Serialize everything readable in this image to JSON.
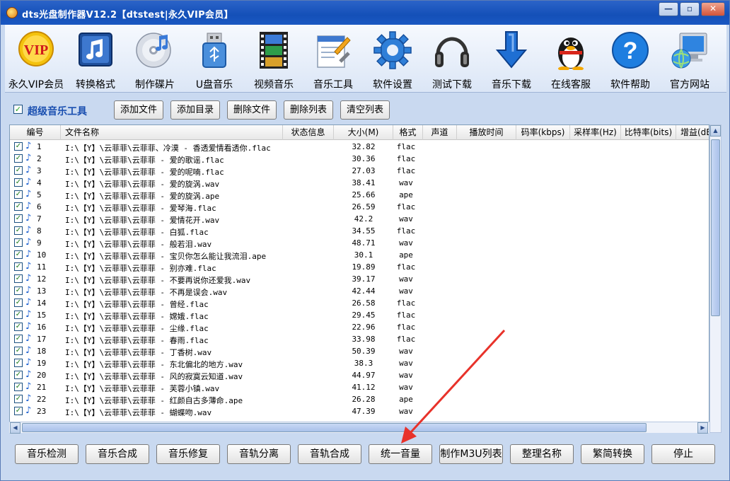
{
  "window": {
    "title": "dts光盘制作器V12.2【dtstest|永久VIP会员】",
    "controls": {
      "minimize": "—",
      "restore": "▫",
      "close": "✕"
    }
  },
  "toolbar": {
    "items": [
      {
        "label": "永久VIP会员",
        "icon": "vip-badge-icon"
      },
      {
        "label": "转换格式",
        "icon": "music-note-icon"
      },
      {
        "label": "制作碟片",
        "icon": "disc-icon"
      },
      {
        "label": "U盘音乐",
        "icon": "usb-drive-icon"
      },
      {
        "label": "视频音乐",
        "icon": "film-strip-icon"
      },
      {
        "label": "音乐工具",
        "icon": "tools-document-icon"
      },
      {
        "label": "软件设置",
        "icon": "gear-icon"
      },
      {
        "label": "测试下载",
        "icon": "headphones-icon"
      },
      {
        "label": "音乐下载",
        "icon": "download-arrow-icon"
      },
      {
        "label": "在线客服",
        "icon": "penguin-icon"
      },
      {
        "label": "软件帮助",
        "icon": "question-icon"
      },
      {
        "label": "官方网站",
        "icon": "computer-globe-icon"
      }
    ]
  },
  "panel": {
    "title": "超级音乐工具",
    "buttons": [
      "添加文件",
      "添加目录",
      "删除文件",
      "删除列表",
      "清空列表"
    ]
  },
  "list": {
    "columns": [
      "编号",
      "文件名称",
      "状态信息",
      "大小(M)",
      "格式",
      "声道",
      "播放时间",
      "码率(kbps)",
      "采样率(Hz)",
      "比特率(bits)",
      "增益(dB"
    ],
    "rows": [
      {
        "num": "1",
        "name": "I:\\【Y】\\云菲菲\\云菲菲、冷漠 - 香透爱情看透你.flac",
        "size": "32.82",
        "fmt": "flac"
      },
      {
        "num": "2",
        "name": "I:\\【Y】\\云菲菲\\云菲菲 - 爱的歌谣.flac",
        "size": "30.36",
        "fmt": "flac"
      },
      {
        "num": "3",
        "name": "I:\\【Y】\\云菲菲\\云菲菲 - 爱的呢喃.flac",
        "size": "27.03",
        "fmt": "flac"
      },
      {
        "num": "4",
        "name": "I:\\【Y】\\云菲菲\\云菲菲 - 爱的旋涡.wav",
        "size": "38.41",
        "fmt": "wav"
      },
      {
        "num": "5",
        "name": "I:\\【Y】\\云菲菲\\云菲菲 - 爱的旋涡.ape",
        "size": "25.66",
        "fmt": "ape"
      },
      {
        "num": "6",
        "name": "I:\\【Y】\\云菲菲\\云菲菲 - 爱琴海.flac",
        "size": "26.59",
        "fmt": "flac"
      },
      {
        "num": "7",
        "name": "I:\\【Y】\\云菲菲\\云菲菲 - 爱情花开.wav",
        "size": "42.2",
        "fmt": "wav"
      },
      {
        "num": "8",
        "name": "I:\\【Y】\\云菲菲\\云菲菲 - 白狐.flac",
        "size": "34.55",
        "fmt": "flac"
      },
      {
        "num": "9",
        "name": "I:\\【Y】\\云菲菲\\云菲菲 - 般若泪.wav",
        "size": "48.71",
        "fmt": "wav"
      },
      {
        "num": "10",
        "name": "I:\\【Y】\\云菲菲\\云菲菲 - 宝贝你怎么能让我流泪.ape",
        "size": "30.1",
        "fmt": "ape"
      },
      {
        "num": "11",
        "name": "I:\\【Y】\\云菲菲\\云菲菲 - 别亦难.flac",
        "size": "19.89",
        "fmt": "flac"
      },
      {
        "num": "12",
        "name": "I:\\【Y】\\云菲菲\\云菲菲 - 不要再说你还爱我.wav",
        "size": "39.17",
        "fmt": "wav"
      },
      {
        "num": "13",
        "name": "I:\\【Y】\\云菲菲\\云菲菲 - 不再是误会.wav",
        "size": "42.44",
        "fmt": "wav"
      },
      {
        "num": "14",
        "name": "I:\\【Y】\\云菲菲\\云菲菲 - 曾经.flac",
        "size": "26.58",
        "fmt": "flac"
      },
      {
        "num": "15",
        "name": "I:\\【Y】\\云菲菲\\云菲菲 - 嫦娥.flac",
        "size": "29.45",
        "fmt": "flac"
      },
      {
        "num": "16",
        "name": "I:\\【Y】\\云菲菲\\云菲菲 - 尘缘.flac",
        "size": "22.96",
        "fmt": "flac"
      },
      {
        "num": "17",
        "name": "I:\\【Y】\\云菲菲\\云菲菲 - 春雨.flac",
        "size": "33.98",
        "fmt": "flac"
      },
      {
        "num": "18",
        "name": "I:\\【Y】\\云菲菲\\云菲菲 - 丁香树.wav",
        "size": "50.39",
        "fmt": "wav"
      },
      {
        "num": "19",
        "name": "I:\\【Y】\\云菲菲\\云菲菲 - 东北偏北的地方.wav",
        "size": "38.3",
        "fmt": "wav"
      },
      {
        "num": "20",
        "name": "I:\\【Y】\\云菲菲\\云菲菲 - 风的寂寞云知道.wav",
        "size": "44.97",
        "fmt": "wav"
      },
      {
        "num": "21",
        "name": "I:\\【Y】\\云菲菲\\云菲菲 - 芙蓉小镇.wav",
        "size": "41.12",
        "fmt": "wav"
      },
      {
        "num": "22",
        "name": "I:\\【Y】\\云菲菲\\云菲菲 - 红颜自古多薄命.ape",
        "size": "26.28",
        "fmt": "ape"
      },
      {
        "num": "23",
        "name": "I:\\【Y】\\云菲菲\\云菲菲 - 蝴蝶吻.wav",
        "size": "47.39",
        "fmt": "wav"
      }
    ]
  },
  "bottom": {
    "buttons": [
      "音乐检测",
      "音乐合成",
      "音乐修复",
      "音轨分离",
      "音轨合成",
      "统一音量",
      "制作M3U列表",
      "整理名称",
      "繁简转换",
      "停止"
    ]
  },
  "colors": {
    "accent": "#1a4fb0",
    "titlebar": "#1450b8",
    "arrow": "#e8322a"
  }
}
